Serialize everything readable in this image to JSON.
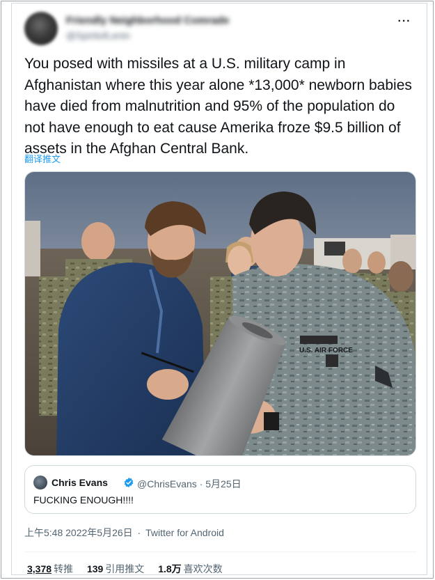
{
  "author": {
    "name": "Friendly Neighborhood Comrade",
    "handle": "@SpiritofLenin"
  },
  "tweet": {
    "text": "You posed with missiles at a U.S. military camp in Afghanistan where this year alone *13,000* newborn babies have died from malnutrition and 95% of the population do not have enough to eat cause Amerika froze $9.5 billion of assets in the Afghan Central Bank.",
    "translate_label": "翻译推文",
    "more_label": "···"
  },
  "photo": {
    "uniform_patch": "U.S. AIR FORCE"
  },
  "quoted_tweet": {
    "name": "Chris Evans",
    "handle": "@ChrisEvans",
    "separator": "·",
    "date": "5月25日",
    "text": "FUCKING ENOUGH!!!!"
  },
  "meta": {
    "time": "上午5:48",
    "separator": "·",
    "date": "2022年5月26日",
    "client": "Twitter for Android"
  },
  "stats": {
    "retweets_count": "3,378",
    "retweets_label": "转推",
    "quotes_count": "139",
    "quotes_label": "引用推文",
    "likes_count": "1.8万",
    "likes_label": "喜欢次数"
  },
  "colors": {
    "accent": "#1d9bf0",
    "text_primary": "#0f1419",
    "text_secondary": "#536471",
    "border": "#cfd9de"
  }
}
